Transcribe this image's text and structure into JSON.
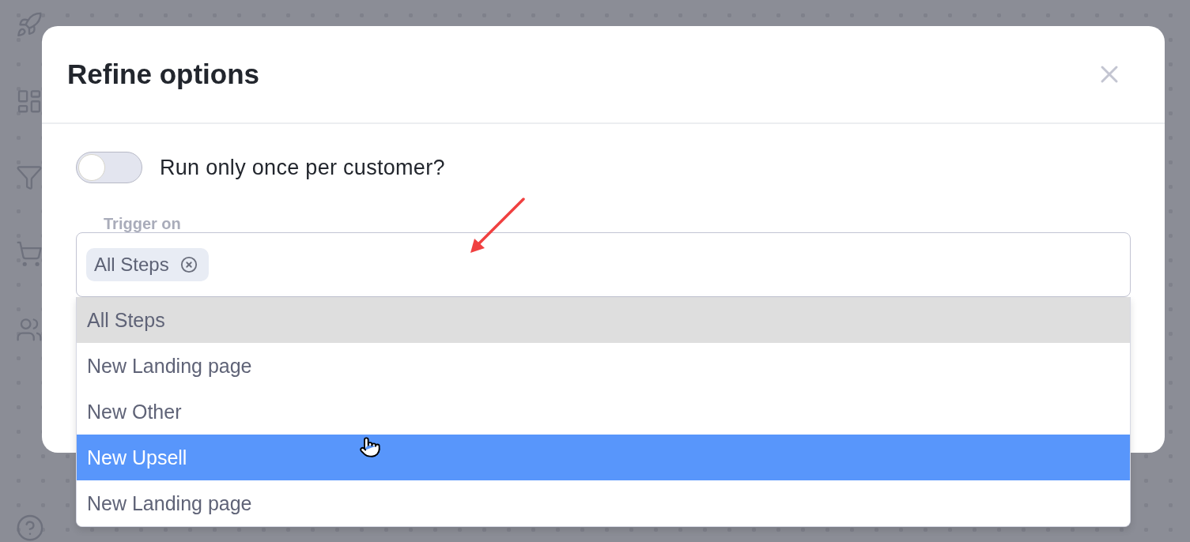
{
  "modal": {
    "title": "Refine options",
    "toggle": {
      "label": "Run only once per customer?",
      "on": false
    },
    "trigger": {
      "label": "Trigger on",
      "chips": [
        "All Steps"
      ],
      "options": [
        {
          "label": "All Steps",
          "selected": true,
          "highlighted": false
        },
        {
          "label": "New Landing page",
          "selected": false,
          "highlighted": false
        },
        {
          "label": "New Other",
          "selected": false,
          "highlighted": false
        },
        {
          "label": "New Upsell",
          "selected": false,
          "highlighted": true
        },
        {
          "label": "New Landing page",
          "selected": false,
          "highlighted": false
        }
      ]
    }
  }
}
